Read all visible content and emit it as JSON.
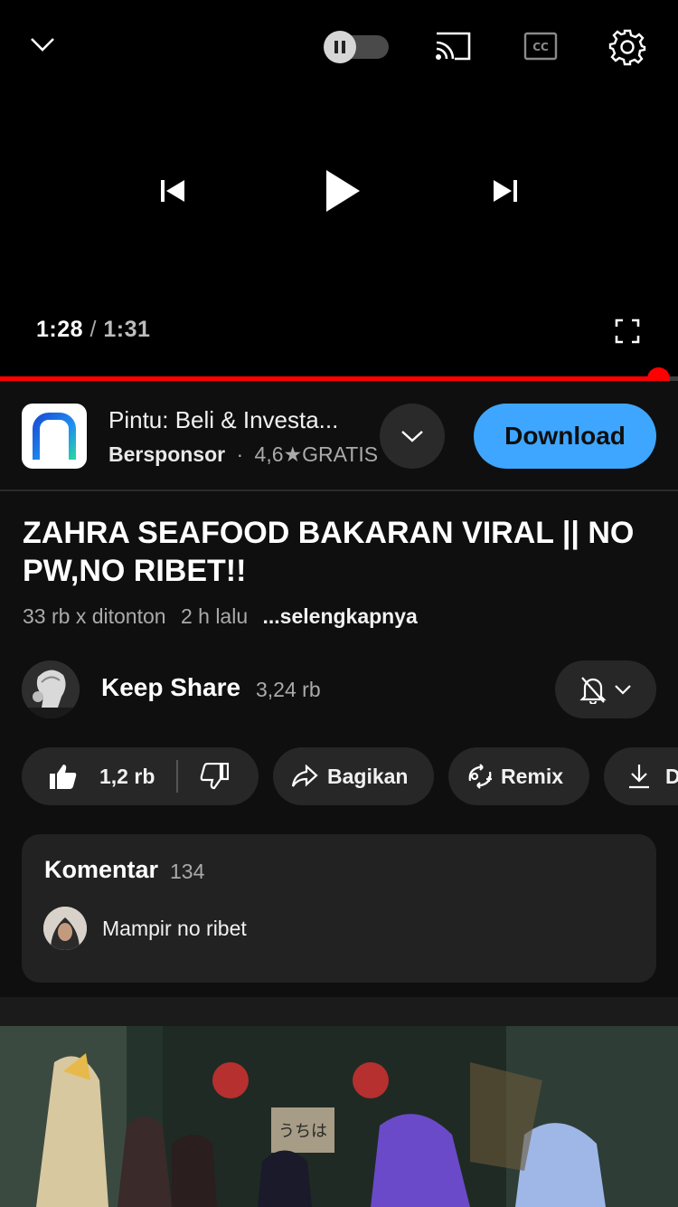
{
  "player": {
    "current_time": "1:28",
    "separator": "/",
    "duration": "1:31",
    "progress_fraction": 0.97,
    "progress_color": "#ff0000"
  },
  "ad": {
    "app_name": "Pintu: Beli & Investa...",
    "sponsored": "Bersponsor",
    "dot": "·",
    "rating": "4,6",
    "price": "GRATIS",
    "cta": "Download",
    "cta_color": "#3ea6ff"
  },
  "video": {
    "title": "ZAHRA SEAFOOD BAKARAN VIRAL || NO PW,NO RIBET!!",
    "views": "33 rb x ditonton",
    "age": "2 h lalu",
    "more": "...selengkapnya"
  },
  "channel": {
    "name": "Keep Share",
    "subscribers": "3,24 rb"
  },
  "actions": {
    "likes": "1,2 rb",
    "share": "Bagikan",
    "remix": "Remix",
    "download": "Download"
  },
  "comments": {
    "heading": "Komentar",
    "count": "134",
    "top_comment": "Mampir no ribet"
  },
  "icons": {
    "collapse": "chevron-down-icon",
    "autoplay": "autoplay-toggle-icon",
    "cast": "cast-icon",
    "captions": "cc-icon",
    "settings": "gear-icon",
    "previous": "skip-previous-icon",
    "play": "play-icon",
    "next": "skip-next-icon",
    "fullscreen": "fullscreen-icon",
    "bell": "bell-off-icon",
    "like": "thumb-up-icon",
    "dislike": "thumb-down-icon",
    "share": "share-icon",
    "remix": "remix-icon",
    "download": "download-icon"
  }
}
